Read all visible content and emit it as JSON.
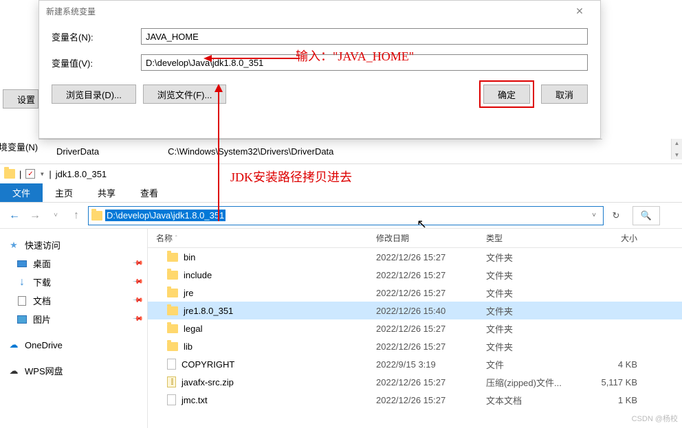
{
  "dialog": {
    "title": "新建系统变量",
    "name_label": "变量名(N):",
    "name_value": "JAVA_HOME",
    "value_label": "变量值(V):",
    "value_value": "D:\\develop\\Java\\jdk1.8.0_351",
    "browse_dir": "浏览目录(D)...",
    "browse_file": "浏览文件(F)...",
    "ok": "确定",
    "cancel": "取消"
  },
  "annotations": {
    "input_hint": "输入：\"JAVA_HOME\"",
    "path_hint": "JDK安装路径拷贝进去"
  },
  "background": {
    "settings": "设置",
    "env_var": "境变量(N)...",
    "driver_data_label": "DriverData",
    "driver_data_path": "C:\\Windows\\System32\\Drivers\\DriverData"
  },
  "explorer": {
    "title_sep": "|",
    "title": "jdk1.8.0_351",
    "tabs": {
      "file": "文件",
      "home": "主页",
      "share": "共享",
      "view": "查看"
    },
    "address": "D:\\develop\\Java\\jdk1.8.0_351",
    "sidebar": {
      "quick": "快速访问",
      "desktop": "桌面",
      "downloads": "下载",
      "documents": "文档",
      "pictures": "图片",
      "onedrive": "OneDrive",
      "wps": "WPS网盘"
    },
    "columns": {
      "name": "名称",
      "date": "修改日期",
      "type": "类型",
      "size": "大小"
    },
    "files": [
      {
        "name": "bin",
        "date": "2022/12/26 15:27",
        "type": "文件夹",
        "size": "",
        "icon": "folder"
      },
      {
        "name": "include",
        "date": "2022/12/26 15:27",
        "type": "文件夹",
        "size": "",
        "icon": "folder"
      },
      {
        "name": "jre",
        "date": "2022/12/26 15:27",
        "type": "文件夹",
        "size": "",
        "icon": "folder"
      },
      {
        "name": "jre1.8.0_351",
        "date": "2022/12/26 15:40",
        "type": "文件夹",
        "size": "",
        "icon": "folder",
        "selected": true
      },
      {
        "name": "legal",
        "date": "2022/12/26 15:27",
        "type": "文件夹",
        "size": "",
        "icon": "folder"
      },
      {
        "name": "lib",
        "date": "2022/12/26 15:27",
        "type": "文件夹",
        "size": "",
        "icon": "folder"
      },
      {
        "name": "COPYRIGHT",
        "date": "2022/9/15 3:19",
        "type": "文件",
        "size": "4 KB",
        "icon": "file"
      },
      {
        "name": "javafx-src.zip",
        "date": "2022/12/26 15:27",
        "type": "压缩(zipped)文件...",
        "size": "5,117 KB",
        "icon": "zip"
      },
      {
        "name": "jmc.txt",
        "date": "2022/12/26 15:27",
        "type": "文本文档",
        "size": "1 KB",
        "icon": "file"
      }
    ]
  },
  "watermark": "CSDN @杨校"
}
